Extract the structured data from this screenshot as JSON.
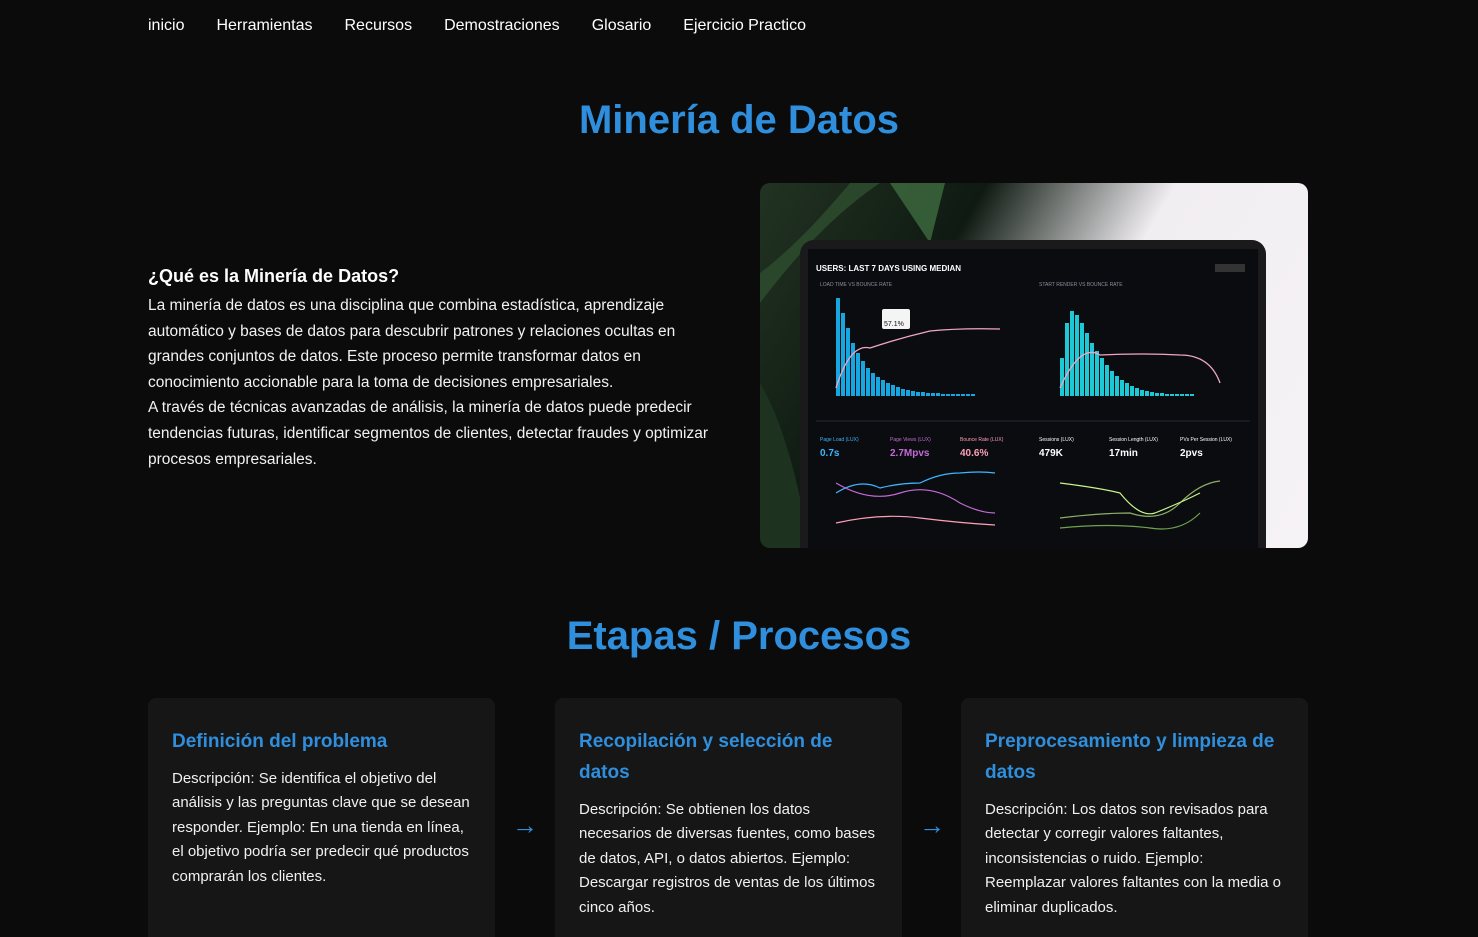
{
  "nav": {
    "items": [
      "inicio",
      "Herramientas",
      "Recursos",
      "Demostraciones",
      "Glosario",
      "Ejercicio Practico"
    ]
  },
  "page_title": "Minería de Datos",
  "intro": {
    "heading": "¿Qué es la Minería de Datos?",
    "paragraph1": "La minería de datos es una disciplina que combina estadística, aprendizaje automático y bases de datos para descubrir patrones y relaciones ocultas en grandes conjuntos de datos. Este proceso permite transformar datos en conocimiento accionable para la toma de decisiones empresariales.",
    "paragraph2": "A través de técnicas avanzadas de análisis, la minería de datos puede predecir tendencias futuras, identificar segmentos de clientes, detectar fraudes y optimizar procesos empresariales."
  },
  "hero_image": {
    "header": "USERS: LAST 7 DAYS USING MEDIAN",
    "panel1_label": "LOAD TIME VS BOUNCE RATE",
    "panel2_label": "START RENDER VS BOUNCE RATE",
    "tooltip": "57.1%",
    "metrics": [
      {
        "label": "Page Load (LUX)",
        "value": "0.7s",
        "color": "#3fb6ff"
      },
      {
        "label": "Page Views (LUX)",
        "value": "2.7Mpvs",
        "color": "#c46bd6"
      },
      {
        "label": "Bounce Rate (LUX)",
        "value": "40.6%",
        "color": "#ff9fb7"
      },
      {
        "label": "Sessions (LUX)",
        "value": "479K",
        "color": "#ffffff"
      },
      {
        "label": "Session Length (LUX)",
        "value": "17min",
        "color": "#ffffff"
      },
      {
        "label": "PVs Per Session (LUX)",
        "value": "2pvs",
        "color": "#ffffff"
      }
    ]
  },
  "section_title": "Etapas / Procesos",
  "stages": [
    {
      "title": "Definición del problema",
      "description": "Descripción: Se identifica el objetivo del análisis y las preguntas clave que se desean responder. Ejemplo: En una tienda en línea, el objetivo podría ser predecir qué productos comprarán los clientes."
    },
    {
      "title": "Recopilación y selección de datos",
      "description": "Descripción: Se obtienen los datos necesarios de diversas fuentes, como bases de datos, API, o datos abiertos. Ejemplo: Descargar registros de ventas de los últimos cinco años."
    },
    {
      "title": "Preprocesamiento y limpieza de datos",
      "description": "Descripción: Los datos son revisados para detectar y corregir valores faltantes, inconsistencias o ruido. Ejemplo: Reemplazar valores faltantes con la media o eliminar duplicados."
    }
  ],
  "arrow_glyph": "→",
  "colors": {
    "accent": "#2f8fdc",
    "background": "#0b0b0c",
    "card": "#161617"
  }
}
